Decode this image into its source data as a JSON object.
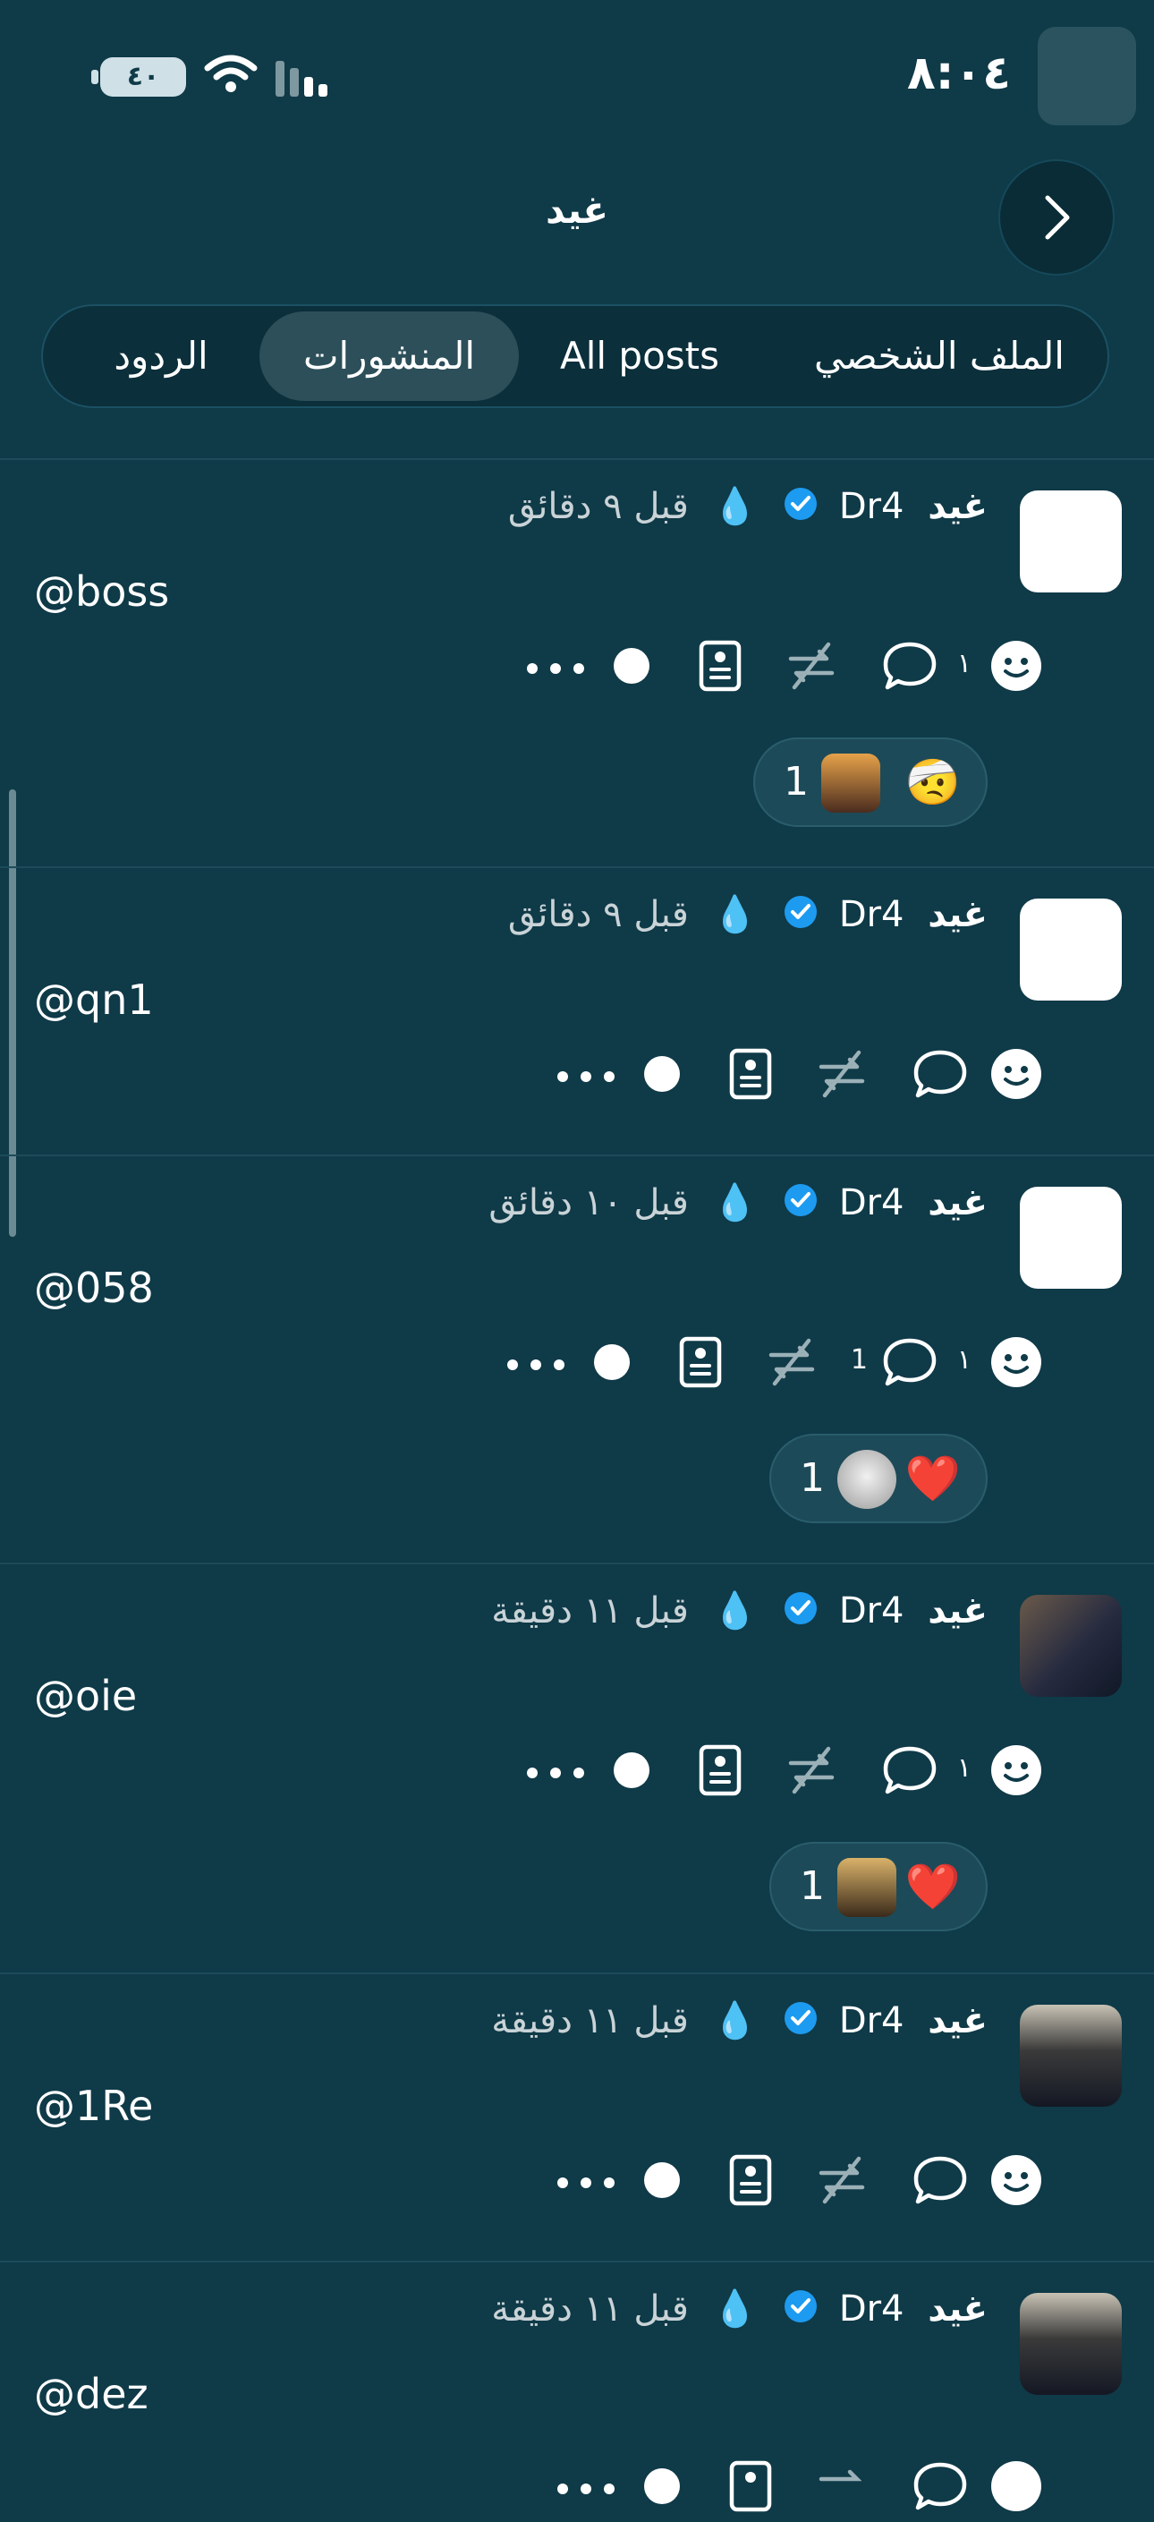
{
  "status_bar": {
    "time": "٨:٠٤",
    "battery": "٤٠"
  },
  "header": {
    "title": "غيد"
  },
  "tabs": [
    {
      "label": "الملف الشخصي",
      "active": false
    },
    {
      "label": "All posts",
      "active": false
    },
    {
      "label": "المنشورات",
      "active": true
    },
    {
      "label": "الردود",
      "active": false
    }
  ],
  "posts": [
    {
      "name": "غيد",
      "handle": "Dr4",
      "time": "قبل ٩ دقائق",
      "text": "@boss",
      "likes": "١",
      "comments": "",
      "reaction_count": "1",
      "reaction_emoji": "🤕"
    },
    {
      "name": "غيد",
      "handle": "Dr4",
      "time": "قبل ٩ دقائق",
      "text": "@qn1",
      "likes": "",
      "comments": ""
    },
    {
      "name": "غيد",
      "handle": "Dr4",
      "time": "قبل ١٠ دقائق",
      "text": "@058",
      "likes": "١",
      "comments": "1",
      "reaction_count": "1",
      "reaction_emoji": "❤️"
    },
    {
      "name": "غيد",
      "handle": "Dr4",
      "time": "قبل ١١ دقيقة",
      "text": "@oie",
      "likes": "١",
      "comments": "",
      "reaction_count": "1",
      "reaction_emoji": "❤️"
    },
    {
      "name": "غيد",
      "handle": "Dr4",
      "time": "قبل ١١ دقيقة",
      "text": "@1Re",
      "likes": "",
      "comments": ""
    },
    {
      "name": "غيد",
      "handle": "Dr4",
      "time": "قبل ١١ دقيقة",
      "text": "@dez",
      "likes": "",
      "comments": ""
    }
  ],
  "colors": {
    "background": "#0f3a48",
    "verified": "#1d9bf0",
    "reaction_pill": "#1d4a58"
  }
}
